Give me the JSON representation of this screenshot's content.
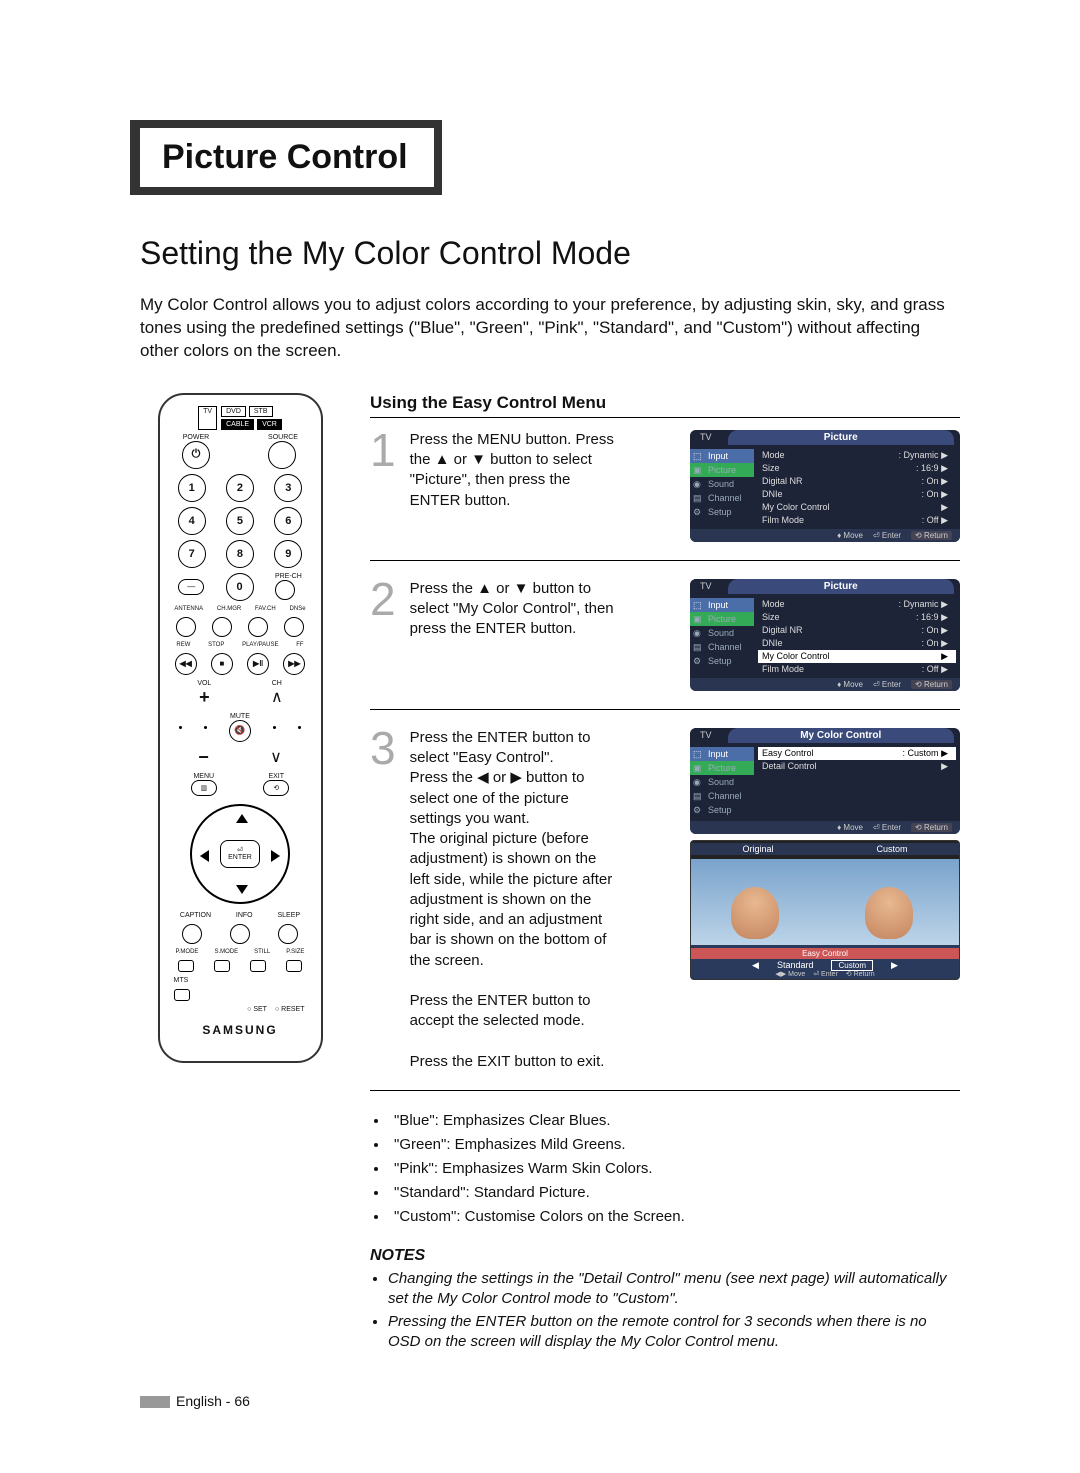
{
  "chapter": "Picture Control",
  "title": "Setting the My Color Control Mode",
  "intro": "My Color Control allows you to adjust colors according to your preference, by adjusting skin, sky, and grass tones using the predefined settings (\"Blue\", \"Green\", \"Pink\", \"Standard\", and \"Custom\") without affecting other colors on the screen.",
  "subhead": "Using the Easy Control Menu",
  "steps": [
    {
      "num": "1",
      "text": "Press the MENU button. Press the ▲ or ▼ button to select \"Picture\", then press the ENTER button.",
      "osd": {
        "tv": "TV",
        "head": "Picture",
        "side": [
          "Input",
          "Picture",
          "Sound",
          "Channel",
          "Setup"
        ],
        "sideSel": 1,
        "rows": [
          {
            "l": "Mode",
            "r": ": Dynamic",
            "hl": false
          },
          {
            "l": "Size",
            "r": ": 16:9",
            "hl": false
          },
          {
            "l": "Digital NR",
            "r": ": On",
            "hl": false
          },
          {
            "l": "DNIe",
            "r": ": On",
            "hl": false
          },
          {
            "l": "My Color Control",
            "r": "",
            "hl": false
          },
          {
            "l": "Film Mode",
            "r": ": Off",
            "hl": false
          }
        ],
        "foot": [
          "Move",
          "Enter",
          "Return"
        ]
      }
    },
    {
      "num": "2",
      "text": "Press the ▲ or ▼ button to select \"My Color Control\", then press the ENTER button.",
      "osd": {
        "tv": "TV",
        "head": "Picture",
        "side": [
          "Input",
          "Picture",
          "Sound",
          "Channel",
          "Setup"
        ],
        "sideSel": 1,
        "rows": [
          {
            "l": "Mode",
            "r": ": Dynamic",
            "hl": false
          },
          {
            "l": "Size",
            "r": ": 16:9",
            "hl": false
          },
          {
            "l": "Digital NR",
            "r": ": On",
            "hl": false
          },
          {
            "l": "DNIe",
            "r": ": On",
            "hl": false
          },
          {
            "l": "My Color Control",
            "r": "",
            "hl": true
          },
          {
            "l": "Film Mode",
            "r": ": Off",
            "hl": false
          }
        ],
        "foot": [
          "Move",
          "Enter",
          "Return"
        ]
      }
    },
    {
      "num": "3",
      "text_parts": [
        "Press the ENTER button to select \"Easy Control\".",
        "Press the ◀ or ▶ button to select one of the picture settings you want.",
        "The original picture (before adjustment) is shown on the left side, while the picture after adjustment is shown on the right side, and an adjustment bar is shown on the bottom of the screen.",
        "Press the ENTER button to accept the selected mode.",
        "Press the EXIT button to exit."
      ],
      "osd": {
        "tv": "TV",
        "head": "My Color Control",
        "side": [
          "Input",
          "Picture",
          "Sound",
          "Channel",
          "Setup"
        ],
        "sideSel": 1,
        "rows": [
          {
            "l": "Easy Control",
            "r": ": Custom",
            "hl": true
          },
          {
            "l": "Detail Control",
            "r": "",
            "hl": false
          }
        ],
        "foot": [
          "Move",
          "Enter",
          "Return"
        ]
      },
      "preview": {
        "leftLabel": "Original",
        "rightLabel": "Custom",
        "barTitle": "Easy Control",
        "options": [
          "Standard",
          "Custom"
        ],
        "foot": [
          "Move",
          "Enter",
          "Return"
        ]
      }
    }
  ],
  "bullets": [
    "\"Blue\": Emphasizes Clear Blues.",
    "\"Green\": Emphasizes Mild Greens.",
    "\"Pink\": Emphasizes Warm Skin Colors.",
    "\"Standard\": Standard Picture.",
    "\"Custom\": Customise Colors on the Screen."
  ],
  "notesTitle": "NOTES",
  "notes": [
    "Changing the settings in the \"Detail Control\" menu (see next page) will automatically set the My Color Control mode to \"Custom\".",
    "Pressing the ENTER button on the remote control for 3 seconds when there is no OSD on the screen will display the My Color Control menu."
  ],
  "footer": "English - 66",
  "remote": {
    "devices1": [
      "DVD",
      "STB"
    ],
    "devices2": [
      "CABLE",
      "VCR"
    ],
    "tv": "TV",
    "power": "POWER",
    "source": "SOURCE",
    "nums": [
      "1",
      "2",
      "3",
      "4",
      "5",
      "6",
      "7",
      "8",
      "9",
      "0"
    ],
    "prech": "PRE-CH",
    "labels1": [
      "ANTENNA",
      "CH.MGR",
      "FAV.CH",
      "DNSe"
    ],
    "transport": [
      "REW",
      "STOP",
      "PLAY/PAUSE",
      "FF"
    ],
    "vol": "VOL",
    "ch": "CH",
    "mute": "MUTE",
    "menu": "MENU",
    "exit": "EXIT",
    "enter": "ENTER",
    "row3": [
      "CAPTION",
      "INFO",
      "SLEEP"
    ],
    "row4": [
      "P.MODE",
      "S.MODE",
      "STILL",
      "P.SIZE"
    ],
    "mts": "MTS",
    "setreset": [
      "SET",
      "RESET"
    ],
    "brand": "SAMSUNG"
  }
}
